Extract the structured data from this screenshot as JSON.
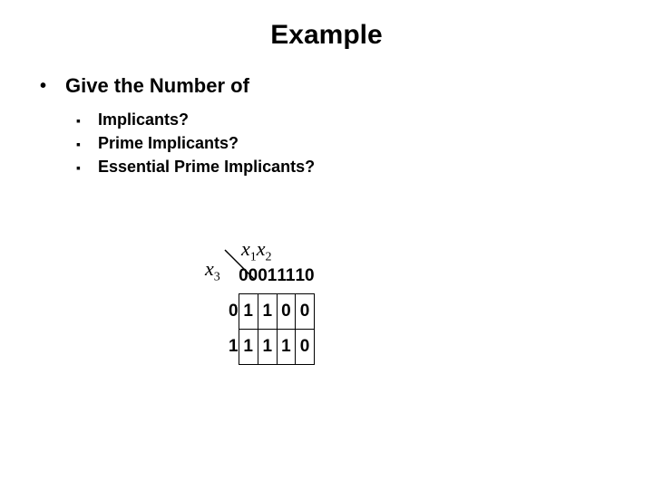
{
  "title": "Example",
  "lvl1": "Give the Number of",
  "lvl2": {
    "a": "Implicants?",
    "b": "Prime Implicants?",
    "c": "Essential Prime Implicants?"
  },
  "kmap": {
    "top_var_html": "x<sub>1</sub>x<sub>2</sub>",
    "left_var_html": "x<sub>3</sub>",
    "col_headers": [
      "00",
      "01",
      "11",
      "10"
    ],
    "row_headers": [
      "0",
      "1"
    ],
    "cells": [
      [
        "1",
        "1",
        "0",
        "0"
      ],
      [
        "1",
        "1",
        "1",
        "0"
      ]
    ]
  },
  "chart_data": {
    "type": "table",
    "title": "K-map",
    "col_variable": "x1x2",
    "row_variable": "x3",
    "columns": [
      "00",
      "01",
      "11",
      "10"
    ],
    "rows": [
      "0",
      "1"
    ],
    "values": [
      [
        1,
        1,
        0,
        0
      ],
      [
        1,
        1,
        1,
        0
      ]
    ]
  }
}
